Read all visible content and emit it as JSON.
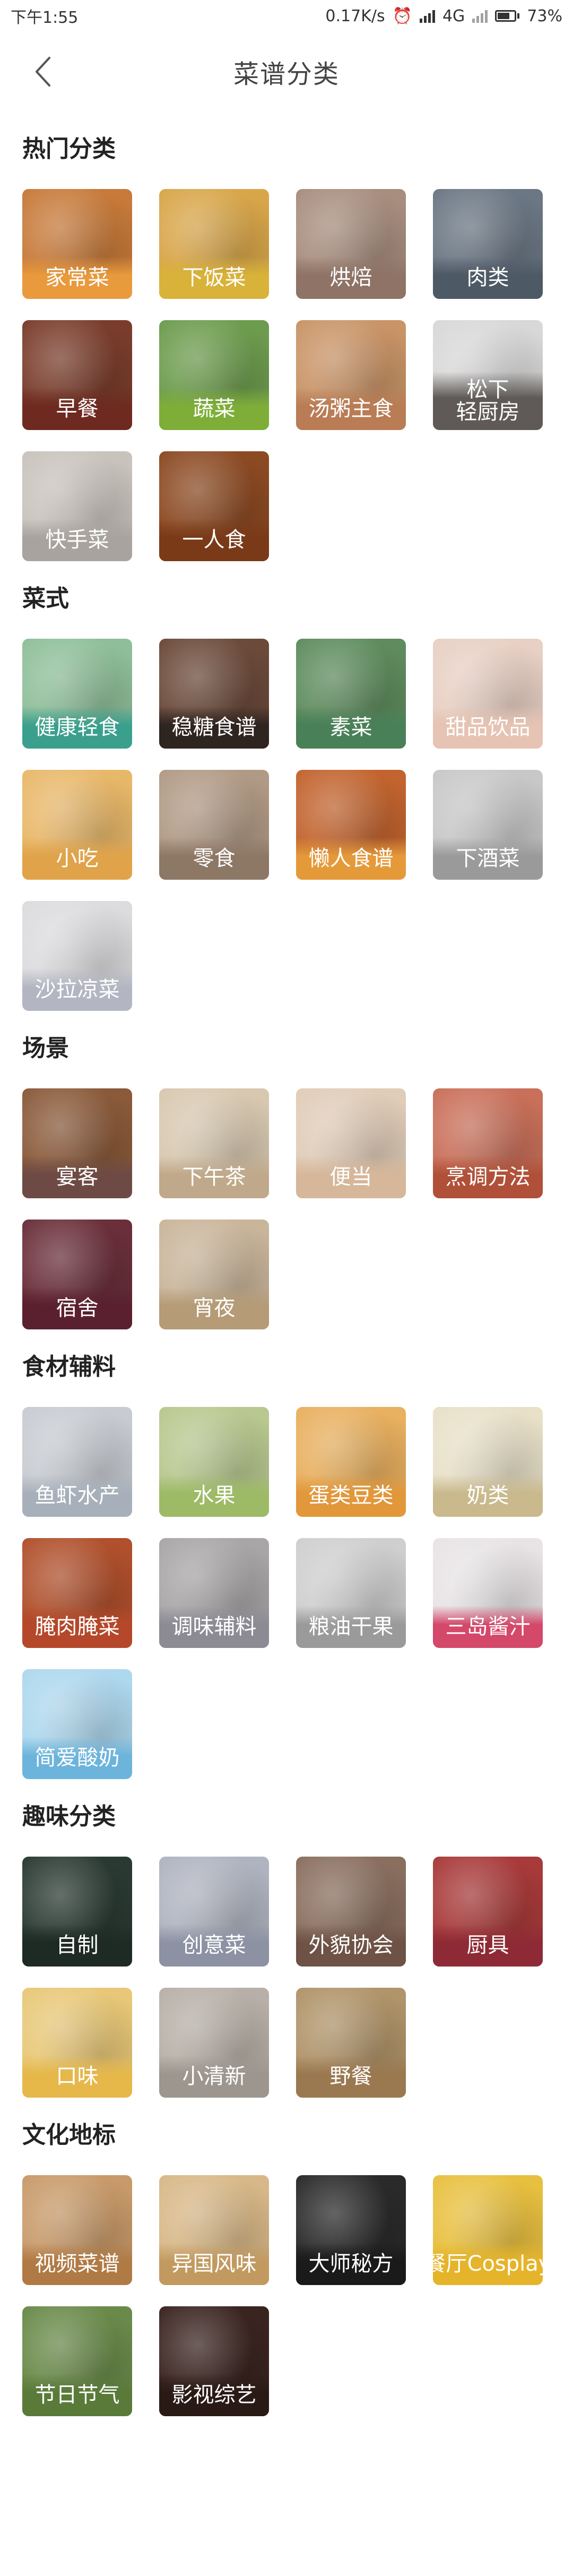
{
  "status": {
    "time": "下午1:55",
    "speed": "0.17K/s",
    "network": "4G",
    "battery": "73%",
    "battery_level": 0.73
  },
  "header": {
    "title": "菜谱分类"
  },
  "sections": [
    {
      "title": "热门分类",
      "items": [
        {
          "label": "家常菜",
          "bg": "#c77a3a",
          "band": "#e89a3c"
        },
        {
          "label": "下饭菜",
          "bg": "#d8a64a",
          "band": "#d9b23a"
        },
        {
          "label": "烘焙",
          "bg": "#a88e7f",
          "band": "#8e7366"
        },
        {
          "label": "肉类",
          "bg": "#6b7784",
          "band": "#4e5966"
        },
        {
          "label": "早餐",
          "bg": "#7a3d2c",
          "band": "#6e2a20"
        },
        {
          "label": "蔬菜",
          "bg": "#6d9c4e",
          "band": "#7fae38"
        },
        {
          "label": "汤粥主食",
          "bg": "#c99467",
          "band": "#b97c55"
        },
        {
          "label": "松下\n轻厨房",
          "bg": "#d8d8d8",
          "band": "#5f5a57"
        },
        {
          "label": "快手菜",
          "bg": "#c9c3bd",
          "band": "#a8a39e"
        },
        {
          "label": "一人食",
          "bg": "#8c4a23",
          "band": "#7a3a18"
        }
      ]
    },
    {
      "title": "菜式",
      "items": [
        {
          "label": "健康轻食",
          "bg": "#8fbf9a",
          "band": "#3aa08d"
        },
        {
          "label": "稳糖食谱",
          "bg": "#6b4a3a",
          "band": "#2e2420"
        },
        {
          "label": "素菜",
          "bg": "#5f8c5e",
          "band": "#4a8058"
        },
        {
          "label": "甜品饮品",
          "bg": "#e8d0c4",
          "band": "#e6c3b2"
        },
        {
          "label": "小吃",
          "bg": "#e8b86a",
          "band": "#e0a34a"
        },
        {
          "label": "零食",
          "bg": "#b19a85",
          "band": "#8d7765"
        },
        {
          "label": "懒人食谱",
          "bg": "#c2642f",
          "band": "#e59a3a"
        },
        {
          "label": "下酒菜",
          "bg": "#c8c8c8",
          "band": "#9a9a9a"
        },
        {
          "label": "沙拉凉菜",
          "bg": "#dcdcde",
          "band": "#b3b6c2"
        }
      ]
    },
    {
      "title": "场景",
      "items": [
        {
          "label": "宴客",
          "bg": "#8a5a3a",
          "band": "#6e4a45"
        },
        {
          "label": "下午茶",
          "bg": "#d8c8b0",
          "band": "#c0a98a"
        },
        {
          "label": "便当",
          "bg": "#e0ccb8",
          "band": "#d6b79a"
        },
        {
          "label": "烹调方法",
          "bg": "#c9705a",
          "band": "#b05038"
        },
        {
          "label": "宿舍",
          "bg": "#6a2f3a",
          "band": "#5a2030"
        },
        {
          "label": "宵夜",
          "bg": "#c9b59a",
          "band": "#b59b76"
        }
      ]
    },
    {
      "title": "食材辅料",
      "items": [
        {
          "label": "鱼虾水产",
          "bg": "#c8ccd2",
          "band": "#a7b0ba"
        },
        {
          "label": "水果",
          "bg": "#b8c890",
          "band": "#9dbb66"
        },
        {
          "label": "蛋类豆类",
          "bg": "#e8b060",
          "band": "#e2973a"
        },
        {
          "label": "奶类",
          "bg": "#e8e0c8",
          "band": "#c9b98c"
        },
        {
          "label": "腌肉腌菜",
          "bg": "#b0502c",
          "band": "#b5482a"
        },
        {
          "label": "调味辅料",
          "bg": "#a9a6a8",
          "band": "#8c8b94"
        },
        {
          "label": "粮油干果",
          "bg": "#cfcfcf",
          "band": "#9a9a9a"
        },
        {
          "label": "三岛酱汁",
          "bg": "#e8e4e6",
          "band": "#d4486a"
        },
        {
          "label": "简爱酸奶",
          "bg": "#aed8ee",
          "band": "#6cb4dc"
        }
      ]
    },
    {
      "title": "趣味分类",
      "items": [
        {
          "label": "自制",
          "bg": "#2a3a32",
          "band": "#1e2a24"
        },
        {
          "label": "创意菜",
          "bg": "#b0b4c0",
          "band": "#8c91a3"
        },
        {
          "label": "外貌协会",
          "bg": "#8a6f5f",
          "band": "#6e5245"
        },
        {
          "label": "厨具",
          "bg": "#a83a3a",
          "band": "#8e2a35"
        },
        {
          "label": "口味",
          "bg": "#e8c878",
          "band": "#e6b84a"
        },
        {
          "label": "小清新",
          "bg": "#b8b0a8",
          "band": "#9c968e"
        },
        {
          "label": "野餐",
          "bg": "#b0946a",
          "band": "#9a7850"
        }
      ]
    },
    {
      "title": "文化地标",
      "items": [
        {
          "label": "视频菜谱",
          "bg": "#c89a6a",
          "band": "#b07a45"
        },
        {
          "label": "异国风味",
          "bg": "#d8b888",
          "band": "#c29a60"
        },
        {
          "label": "大师秘方",
          "bg": "#2a2a2a",
          "band": "#1a1a1a"
        },
        {
          "label": "餐厅Cosplay",
          "bg": "#e8c040",
          "band": "#e6b42a"
        },
        {
          "label": "节日节气",
          "bg": "#6a8a4a",
          "band": "#5a7a3a"
        },
        {
          "label": "影视综艺",
          "bg": "#3a2420",
          "band": "#2a1a16"
        }
      ]
    }
  ]
}
